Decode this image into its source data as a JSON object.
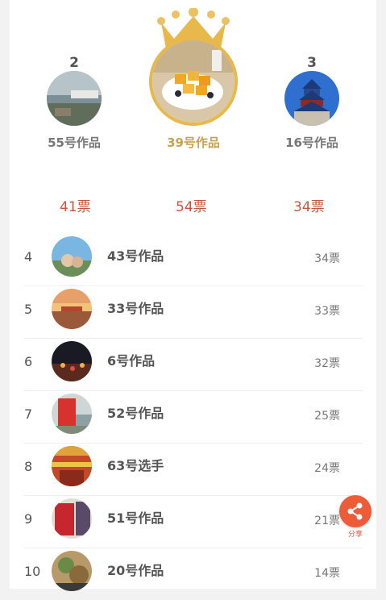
{
  "podium": {
    "second": {
      "rank": "2",
      "title": "55号作品"
    },
    "first": {
      "title": "39号作品"
    },
    "third": {
      "rank": "3",
      "title": "16号作品"
    },
    "votes": [
      "41票",
      "54票",
      "34票"
    ]
  },
  "list": [
    {
      "rank": "4",
      "title": "43号作品",
      "votes": "34票"
    },
    {
      "rank": "5",
      "title": "33号作品",
      "votes": "33票"
    },
    {
      "rank": "6",
      "title": "6号作品",
      "votes": "32票"
    },
    {
      "rank": "7",
      "title": "52号作品",
      "votes": "25票"
    },
    {
      "rank": "8",
      "title": "63号选手",
      "votes": "24票"
    },
    {
      "rank": "9",
      "title": "51号作品",
      "votes": "21票"
    },
    {
      "rank": "10",
      "title": "20号作品",
      "votes": "14票"
    }
  ],
  "share": {
    "label": "分享",
    "icon": "share-icon"
  },
  "colors": {
    "accent": "#ee5b39",
    "gold": "#c7a34a",
    "vote_red": "#c9553a"
  }
}
